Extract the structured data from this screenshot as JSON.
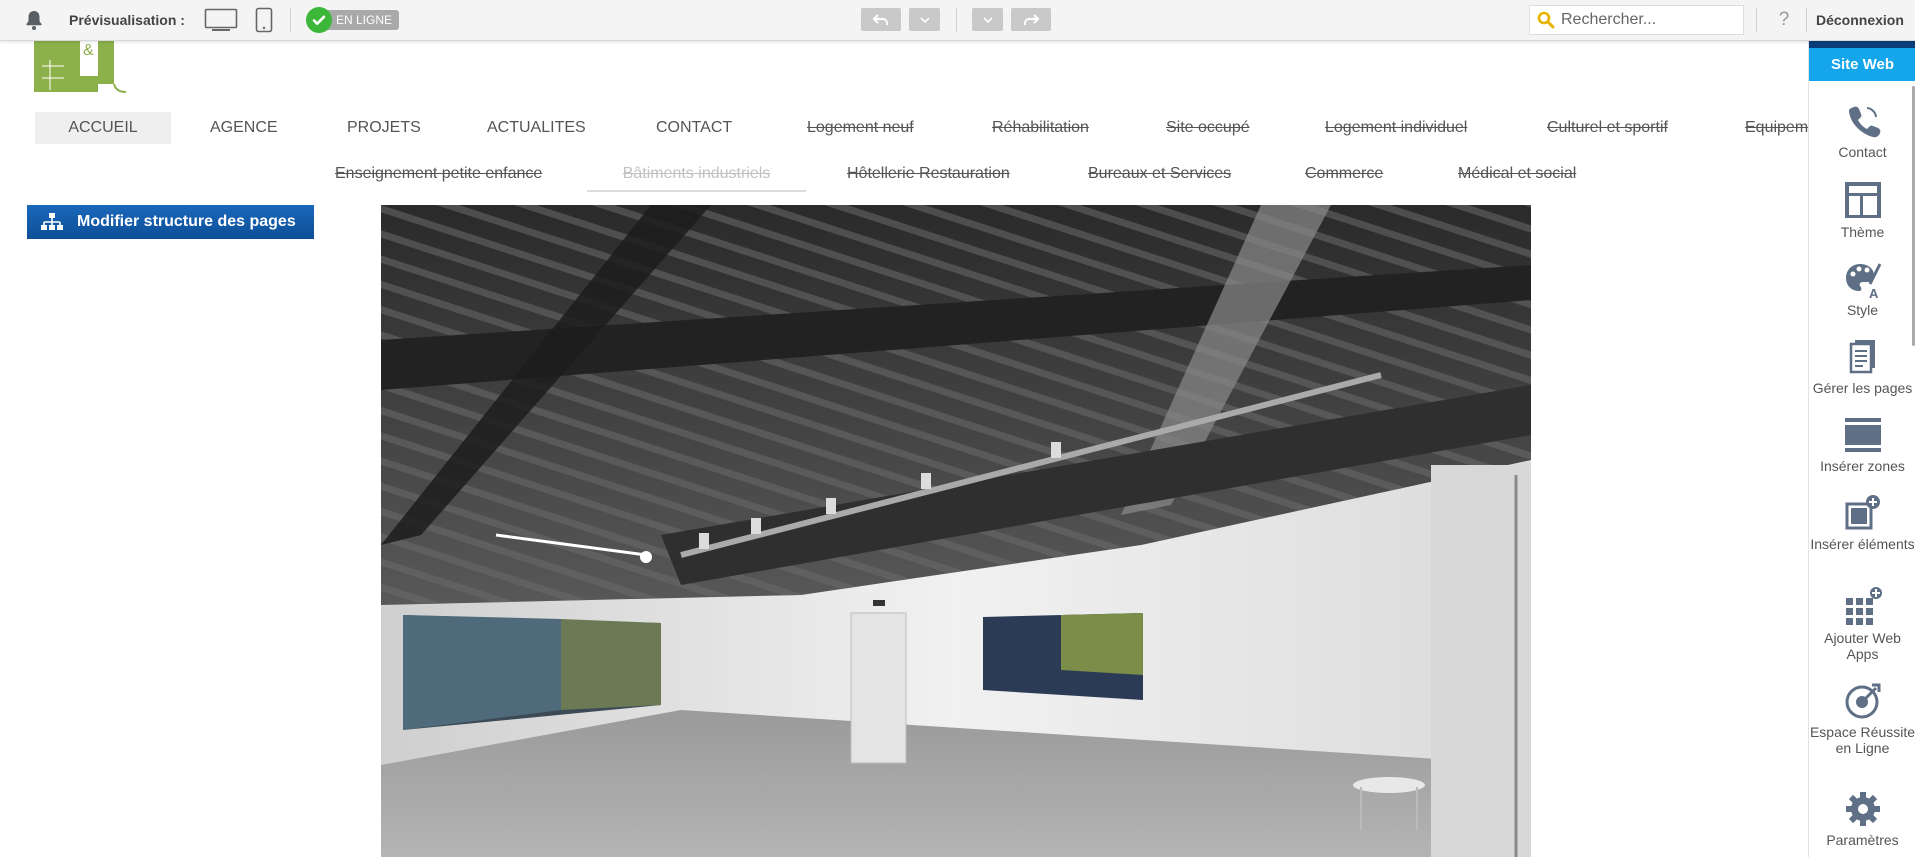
{
  "toolbar": {
    "preview_label": "Prévisualisation :",
    "online_label": "EN LIGNE",
    "search_placeholder": "Rechercher...",
    "help_label": "?",
    "logout_label": "Déconnexion"
  },
  "logo": {
    "text": "&"
  },
  "nav": {
    "row1": [
      {
        "label": "ACCUEIL"
      },
      {
        "label": "AGENCE"
      },
      {
        "label": "PROJETS"
      },
      {
        "label": "ACTUALITES"
      },
      {
        "label": "CONTACT"
      },
      {
        "label": "Logement neuf"
      },
      {
        "label": "Réhabilitation"
      },
      {
        "label": "Site occupé"
      },
      {
        "label": "Logement individuel"
      },
      {
        "label": "Culturel et sportif"
      },
      {
        "label": "Equipem"
      }
    ],
    "row2": [
      {
        "label": "Enseignement petite enfance"
      },
      {
        "label": "Bâtiments industriels"
      },
      {
        "label": "Hôtellerie Restauration"
      },
      {
        "label": "Bureaux et Services"
      },
      {
        "label": "Commerce"
      },
      {
        "label": "Médical et social"
      }
    ]
  },
  "modify_button": {
    "label": "Modifier structure des pages"
  },
  "sidebar": {
    "header": "Site Web",
    "items": [
      {
        "label": "Contact",
        "icon": "phone-icon"
      },
      {
        "label": "Thème",
        "icon": "layout-icon"
      },
      {
        "label": "Style",
        "icon": "palette-icon"
      },
      {
        "label": "Gérer les pages",
        "icon": "pages-icon"
      },
      {
        "label": "Insérer zones",
        "icon": "zones-icon"
      },
      {
        "label": "Insérer éléments",
        "icon": "elements-icon"
      },
      {
        "label": "Ajouter Web Apps",
        "icon": "apps-grid-icon"
      },
      {
        "label": "Espace Réussite en Ligne",
        "icon": "success-icon"
      },
      {
        "label": "Paramètres",
        "icon": "gear-icon"
      }
    ]
  },
  "colors": {
    "accent_blue": "#15a5ea",
    "button_blue": "#1a68bb",
    "online_green": "#3db73a",
    "logo_green": "#8cb04a"
  }
}
